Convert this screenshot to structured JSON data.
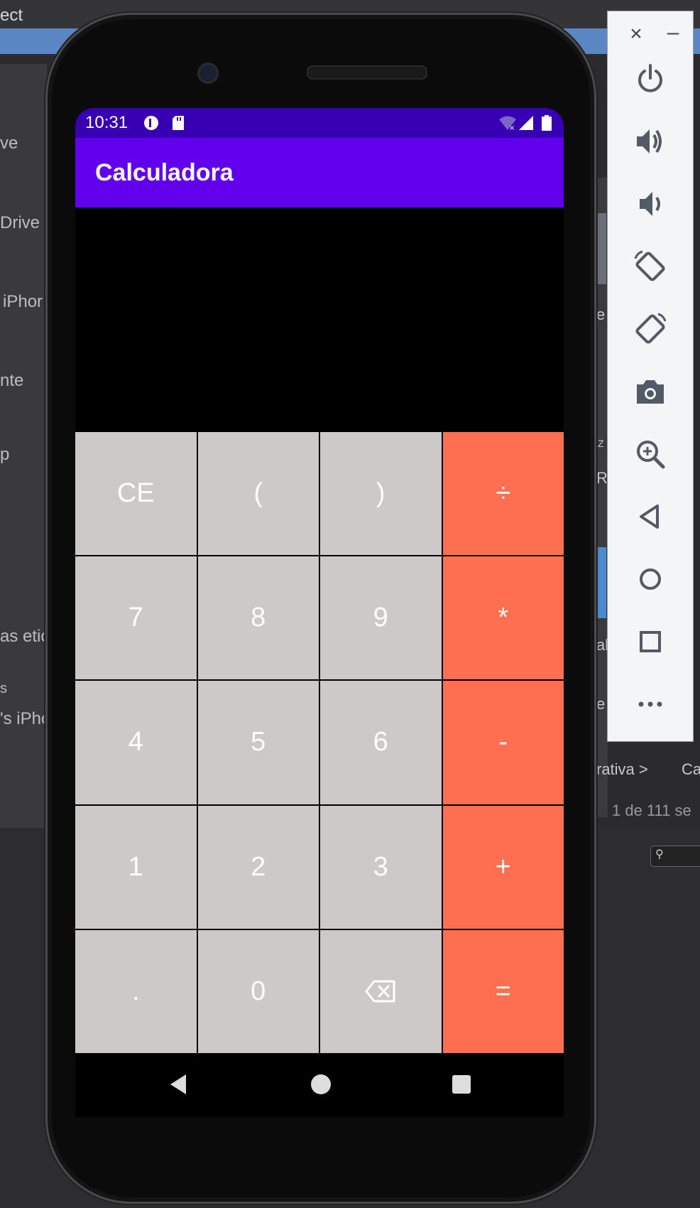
{
  "background": {
    "top_text": "ect",
    "left_items": [
      "ve",
      "Drive",
      "iPhor",
      "nte",
      "p",
      "as etic",
      "s",
      "'s iPho"
    ],
    "right_texts": [
      "e",
      "R",
      "al",
      "e",
      "rativa >",
      "Ca",
      "1 de 111 se",
      "Z"
    ]
  },
  "statusbar": {
    "time": "10:31"
  },
  "app": {
    "title": "Calculadora"
  },
  "display": {
    "value": ""
  },
  "keys": {
    "ce": "CE",
    "lparen": "(",
    "rparen": ")",
    "divide": "÷",
    "k7": "7",
    "k8": "8",
    "k9": "9",
    "multiply": "*",
    "k4": "4",
    "k5": "5",
    "k6": "6",
    "minus": "-",
    "k1": "1",
    "k2": "2",
    "k3": "3",
    "plus": "+",
    "dot": ".",
    "k0": "0",
    "equals": "="
  },
  "emulator_toolbar": {
    "close": "×",
    "minimize": "–"
  },
  "colors": {
    "status": "#3700b3",
    "appbar": "#6200ee",
    "key_gray": "#cdc9c8",
    "key_orange": "#fe6f51"
  }
}
